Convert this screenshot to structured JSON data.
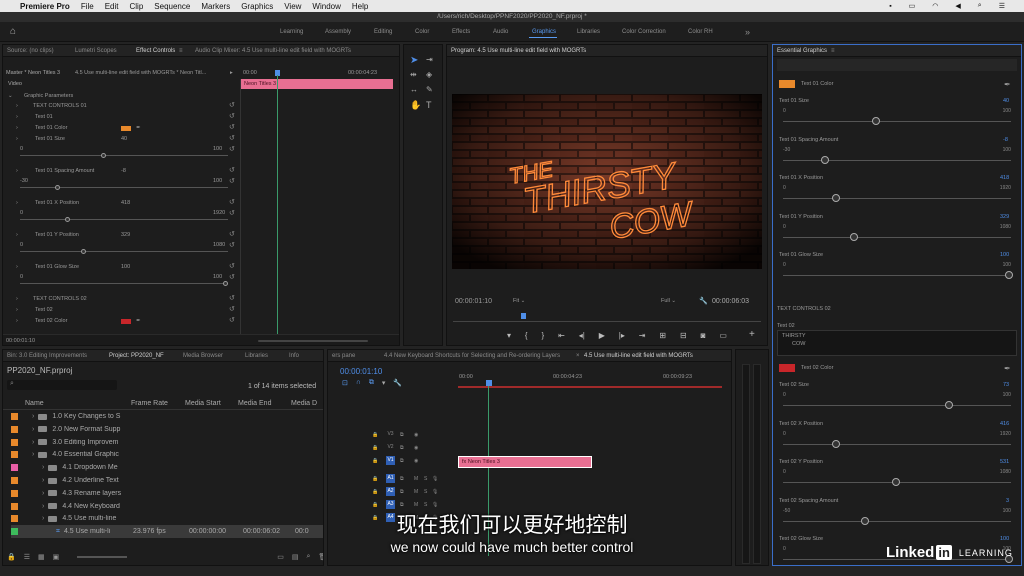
{
  "menubar": {
    "apple": "",
    "app": "Premiere Pro",
    "items": [
      "File",
      "Edit",
      "Clip",
      "Sequence",
      "Markers",
      "Graphics",
      "View",
      "Window",
      "Help"
    ]
  },
  "titlebar": {
    "path": "/Users/rich/Desktop/PPNF2020/PP2020_NF.prproj *"
  },
  "workspaces": [
    "Learning",
    "Assembly",
    "Editing",
    "Color",
    "Effects",
    "Audio",
    "Graphics",
    "Libraries",
    "Color Correction",
    "Color RH"
  ],
  "workspace_active": "Graphics",
  "workspace_more": "»",
  "source_panel": {
    "tabs": [
      "Source: (no clips)",
      "Lumetri Scopes",
      "Effect Controls",
      "Audio Clip Mixer: 4.5 Use multi-line edit field with MOGRTs"
    ],
    "tab_menu": "≡",
    "master": "Master * Neon Titles 3",
    "clip": "4.5 Use multi-line edit field with MOGRTs * Neon Titl...",
    "time_start": "00:00",
    "time_end": "00:00:04:23",
    "clip_bar": "Neon Titles 3",
    "current_time": "00:00:01:10",
    "section_video": "Video",
    "section_gp": "Graphic Parameters",
    "rows": [
      {
        "label": "TEXT CONTROLS 01"
      },
      {
        "label": "Text 01"
      },
      {
        "label": "Text 01 Color"
      },
      {
        "label": "Text 01 Size",
        "value": "40",
        "min": "0",
        "max": "100",
        "knob": 0.4
      },
      {
        "label": "Text 01 Spacing Amount",
        "value": "-8",
        "min": "-30",
        "max": "100",
        "knob": 0.17
      },
      {
        "label": "Text 01 X Position",
        "value": "418",
        "min": "0",
        "max": "1920",
        "knob": 0.22
      },
      {
        "label": "Text 01 Y Position",
        "value": "329",
        "min": "0",
        "max": "1080",
        "knob": 0.3
      },
      {
        "label": "Text 01 Glow Size",
        "value": "100",
        "min": "0",
        "max": "100",
        "knob": 1.0
      },
      {
        "label": "TEXT CONTROLS 02"
      },
      {
        "label": "Text 02"
      },
      {
        "label": "Text 02 Color"
      }
    ]
  },
  "program": {
    "title": "Program: 4.5 Use multi-line edit field with MOGRTs",
    "timecode": "00:00:01:10",
    "fit": "Fit",
    "full": "Full",
    "duration": "00:00:06:03",
    "neon_lines": [
      "THE",
      "THIRSTY",
      "COW"
    ]
  },
  "project_panel": {
    "tabs": [
      "Bin: 3.0 Editing Improvements",
      "Project: PP2020_NF",
      "Media Browser",
      "Libraries",
      "Info"
    ],
    "filename": "PP2020_NF.prproj",
    "count": "1 of 14 items selected",
    "columns": [
      "Name",
      "Frame Rate",
      "Media Start",
      "Media End",
      "Media D"
    ],
    "items": [
      {
        "name": "1.0 Key Changes to S",
        "color": "#e8892b",
        "indent": 0
      },
      {
        "name": "2.0 New Format Supp",
        "color": "#e8892b",
        "indent": 0
      },
      {
        "name": "3.0 Editing Improvem",
        "color": "#e8892b",
        "indent": 0
      },
      {
        "name": "4.0 Essential Graphic",
        "color": "#e8892b",
        "indent": 0
      },
      {
        "name": "4.1 Dropdown Me",
        "color": "#e85fa6",
        "indent": 1
      },
      {
        "name": "4.2 Underline Text",
        "color": "#e8892b",
        "indent": 1
      },
      {
        "name": "4.3 Rename layers",
        "color": "#e8892b",
        "indent": 1
      },
      {
        "name": "4.4 New Keyboard",
        "color": "#e8892b",
        "indent": 1
      },
      {
        "name": "4.5 Use multi-line",
        "color": "#e8892b",
        "indent": 1
      },
      {
        "name": "4.5 Use multi-li",
        "color": "#3dbb5c",
        "indent": 2,
        "fps": "23.976 fps",
        "start": "00:00:00:00",
        "end": "00:00:06:02",
        "dur": "00:0"
      }
    ]
  },
  "timeline": {
    "tabs": [
      "ers pane",
      "4.4 New Keyboard Shortcuts for Selecting and Re-ordering Layers",
      "4.5 Use multi-line edit field with MOGRTs"
    ],
    "current": "00:00:01:10",
    "ruler": [
      "00:00",
      "00:00:04:23",
      "00:00:09:23"
    ],
    "clip": "Neon Titles 3",
    "video_tracks": [
      "V3",
      "V2",
      "V1"
    ],
    "audio_tracks": [
      "A1",
      "A2",
      "A3",
      "A4"
    ],
    "mute": "M",
    "solo": "S"
  },
  "essential_graphics": {
    "title": "Essential Graphics",
    "menu": "≡",
    "rows": [
      {
        "type": "color",
        "label": "Text 01 Color",
        "color": "#e8892b"
      },
      {
        "type": "slider",
        "label": "Text 01 Size",
        "value": "40",
        "min": "0",
        "max": "100",
        "knob": 0.4
      },
      {
        "type": "slider",
        "label": "Text 01 Spacing Amount",
        "value": "-8",
        "min": "-30",
        "max": "100",
        "knob": 0.17
      },
      {
        "type": "slider",
        "label": "Text 01 X Position",
        "value": "418",
        "min": "0",
        "max": "1920",
        "knob": 0.22
      },
      {
        "type": "slider",
        "label": "Text 01 Y Position",
        "value": "329",
        "min": "0",
        "max": "1080",
        "knob": 0.3
      },
      {
        "type": "slider",
        "label": "Text 01 Glow Size",
        "value": "100",
        "min": "0",
        "max": "100",
        "knob": 1.0
      }
    ],
    "section2": "TEXT CONTROLS 02",
    "text02_label": "Text 02",
    "text02_lines": [
      "THIRSTY",
      "COW"
    ],
    "rows2": [
      {
        "type": "color",
        "label": "Text 02 Color",
        "color": "#c8262a"
      },
      {
        "type": "slider",
        "label": "Text 02 Size",
        "value": "73",
        "min": "0",
        "max": "100",
        "knob": 0.73
      },
      {
        "type": "slider",
        "label": "Text 02 X Position",
        "value": "416",
        "min": "0",
        "max": "1920",
        "knob": 0.22
      },
      {
        "type": "slider",
        "label": "Text 02 Y Position",
        "value": "531",
        "min": "0",
        "max": "1080",
        "knob": 0.49
      },
      {
        "type": "slider",
        "label": "Text 02 Spacing Amount",
        "value": "3",
        "min": "-50",
        "max": "100",
        "knob": 0.35
      },
      {
        "type": "slider",
        "label": "Text 02 Glow Size",
        "value": "100",
        "min": "0",
        "max": "100",
        "knob": 1.0
      }
    ]
  },
  "subtitles": {
    "chinese": "现在我们可以更好地控制",
    "english": "we now could have much better control"
  },
  "watermark": {
    "linked": "Linked",
    "in": "in",
    "learning": "LEARNING"
  }
}
